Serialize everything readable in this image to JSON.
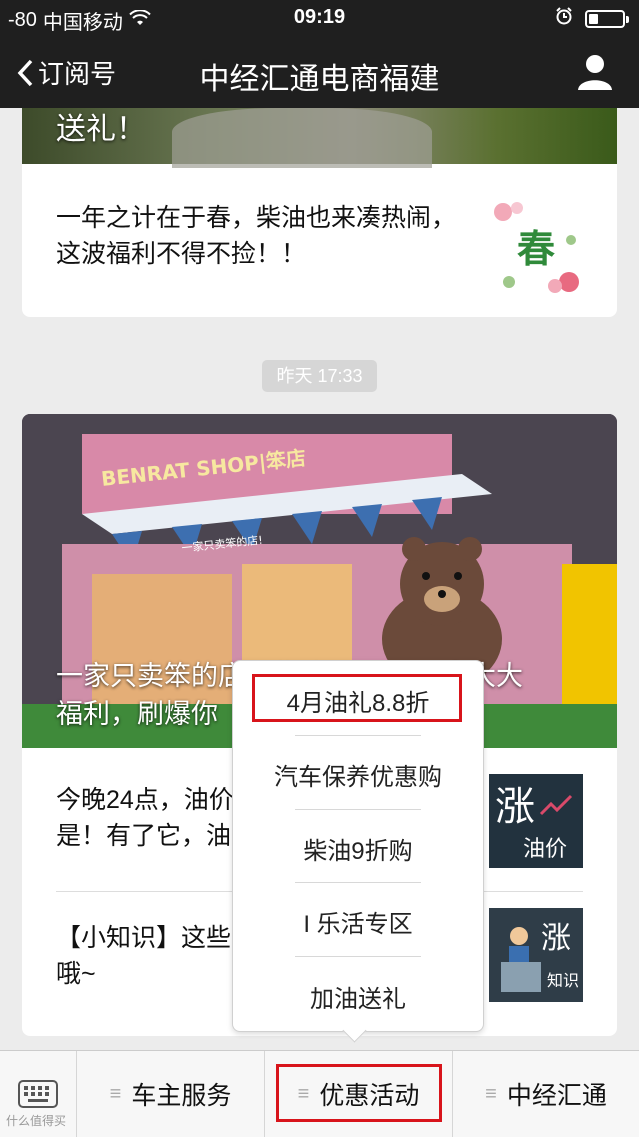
{
  "status_bar": {
    "signal": "-80",
    "carrier": "中国移动",
    "time": "09:19"
  },
  "nav": {
    "back_label": "订阅号",
    "title": "中经汇通电商福建"
  },
  "card1": {
    "image_caption": "送礼！",
    "article_text": "一年之计在于春，柴油也来凑热闹，这波福利不得不捡！！",
    "thumb_char": "春"
  },
  "timestamp": "昨天 17:33",
  "card2": {
    "shop_sign": "BENRAT SHOP|笨店",
    "shop_subsign": "一家只卖笨的店!",
    "headline": "一家只卖笨的店，柴油",
    "headline_line2": "福利，刷爆你",
    "headline_tail": "大大大",
    "articles": [
      {
        "text_line1": "今晚24点，油价",
        "text_line2": "是！有了它，油",
        "thumb_big": "涨",
        "thumb_small": "油价"
      },
      {
        "text_line1": "【小知识】这些",
        "text_line2": "哦~",
        "thumb_big": "涨",
        "thumb_small": "知识"
      }
    ]
  },
  "popup_menu": {
    "items": [
      "4月油礼8.8折",
      "汽车保养优惠购",
      "柴油9折购",
      "I 乐活专区",
      "加油送礼"
    ]
  },
  "tab_bar": {
    "tabs": [
      "车主服务",
      "优惠活动",
      "中经汇通"
    ]
  },
  "watermark": "什么值得买",
  "colors": {
    "highlight": "#d8141b",
    "nav_bg": "#1f1f1f"
  }
}
